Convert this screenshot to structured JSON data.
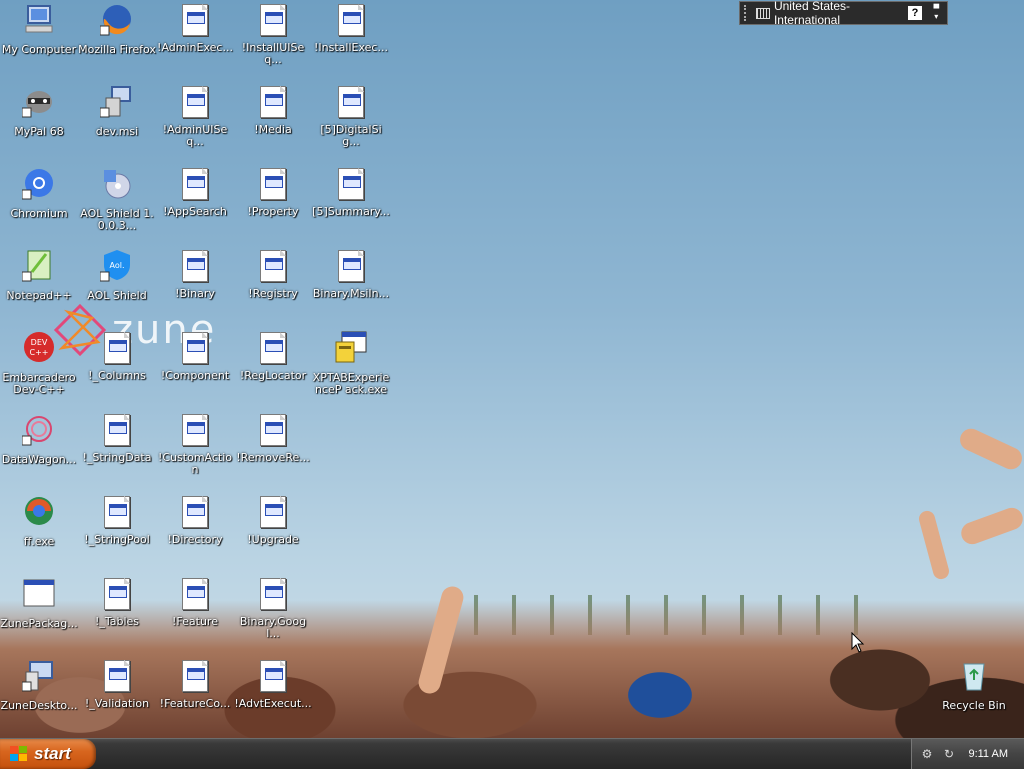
{
  "desktop": {
    "icons": [
      {
        "label": "My Computer"
      },
      {
        "label": "Mozilla Firefox"
      },
      {
        "label": "!AdminExec..."
      },
      {
        "label": "!InstallUISeq..."
      },
      {
        "label": "!InstallExec..."
      },
      {
        "label": "MyPal 68"
      },
      {
        "label": "dev.msi"
      },
      {
        "label": "!AdminUISeq..."
      },
      {
        "label": "!Media"
      },
      {
        "label": "[5]DigitalSig..."
      },
      {
        "label": "Chromium"
      },
      {
        "label": "AOL Shield 1.0.0.3..."
      },
      {
        "label": "!AppSearch"
      },
      {
        "label": "!Property"
      },
      {
        "label": "[5]Summary..."
      },
      {
        "label": "Notepad++"
      },
      {
        "label": "AOL Shield"
      },
      {
        "label": "!Binary"
      },
      {
        "label": "!Registry"
      },
      {
        "label": "Binary.MsiIn..."
      },
      {
        "label": "Embarcadero Dev-C++"
      },
      {
        "label": "!_Columns"
      },
      {
        "label": "!Component"
      },
      {
        "label": "!RegLocator"
      },
      {
        "label": "XPTABExperienceP ack.exe"
      },
      {
        "label": "DataWagon..."
      },
      {
        "label": "!_StringData"
      },
      {
        "label": "!CustomAction"
      },
      {
        "label": "!RemoveRe..."
      },
      {
        "label": "ff.exe"
      },
      {
        "label": "!_StringPool"
      },
      {
        "label": "!Directory"
      },
      {
        "label": "!Upgrade"
      },
      {
        "label": "ZunePackag..."
      },
      {
        "label": "!_Tables"
      },
      {
        "label": "!Feature"
      },
      {
        "label": "Binary.Googl..."
      },
      {
        "label": "ZuneDeskto..."
      },
      {
        "label": "!_Validation"
      },
      {
        "label": "!FeatureCo..."
      },
      {
        "label": "!AdvtExecut..."
      },
      {
        "label": "Recycle Bin"
      }
    ],
    "wallpaper_logo": "zune"
  },
  "language_bar": {
    "language": "United States-International",
    "help_label": "?"
  },
  "taskbar": {
    "start_label": "start",
    "clock": "9:11 AM"
  },
  "colors": {
    "start_button": "#d8661f",
    "taskbar": "#2f2f2f",
    "sky": "#8fb6d2"
  }
}
